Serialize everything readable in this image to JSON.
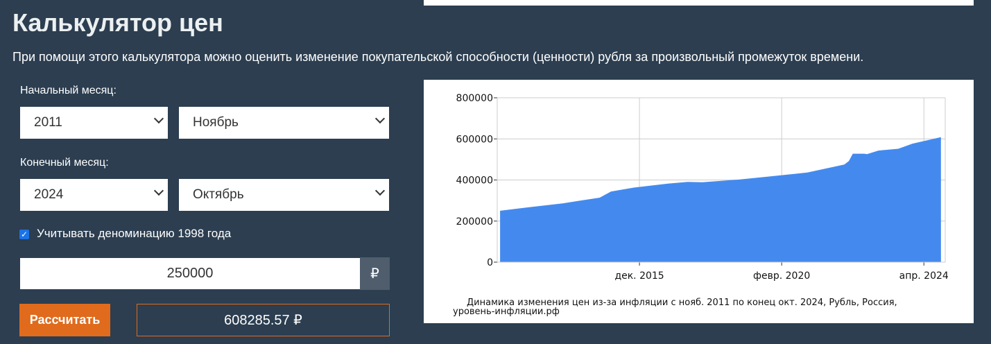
{
  "title": "Калькулятор цен",
  "description": "При помощи этого калькулятора можно оценить изменение покупательской способности (ценности) рубля за произвольный промежуток времени.",
  "start": {
    "label": "Начальный месяц:",
    "year": "2011",
    "month": "Ноябрь"
  },
  "end": {
    "label": "Конечный месяц:",
    "year": "2024",
    "month": "Октябрь"
  },
  "denomination": {
    "label": "Учитывать деноминацию 1998 года",
    "checked": true
  },
  "amount": {
    "value": "250000",
    "currency": "₽"
  },
  "calculate_label": "Рассчитать",
  "result": "608285.57 ₽",
  "colors": {
    "accent": "#e06b1d",
    "fill": "#448aee",
    "bg": "#2c3e50"
  },
  "chart_data": {
    "type": "area",
    "caption_line1": "Динамика изменения цен из-за инфляции с нояб. 2011 по конец окт. 2024, Рубль, Россия,",
    "caption_line2": "уровень-инфляции.рф",
    "x_unit": "months since Nov 2011",
    "xlim": [
      -1,
      156.5
    ],
    "ylim": [
      0,
      800000
    ],
    "yticks": [
      {
        "v": 0,
        "label": "0"
      },
      {
        "v": 200000,
        "label": "200000"
      },
      {
        "v": 400000,
        "label": "400000"
      },
      {
        "v": 600000,
        "label": "600000"
      },
      {
        "v": 800000,
        "label": "800000"
      }
    ],
    "xticks": [
      {
        "v": 49,
        "label": "дек. 2015"
      },
      {
        "v": 99,
        "label": "февр. 2020"
      },
      {
        "v": 149,
        "label": "апр. 2024"
      }
    ],
    "grid": true,
    "points": [
      [
        0,
        250000
      ],
      [
        10,
        267000
      ],
      [
        22,
        286000
      ],
      [
        29,
        301000
      ],
      [
        35,
        314000
      ],
      [
        39,
        344000
      ],
      [
        47,
        363000
      ],
      [
        59,
        382000
      ],
      [
        66,
        391000
      ],
      [
        71,
        389000
      ],
      [
        84,
        402000
      ],
      [
        96,
        419000
      ],
      [
        108,
        436000
      ],
      [
        121,
        475000
      ],
      [
        122.6,
        492000
      ],
      [
        124,
        528000
      ],
      [
        128,
        528000
      ],
      [
        129,
        526000
      ],
      [
        133,
        543000
      ],
      [
        140,
        552000
      ],
      [
        145,
        577000
      ],
      [
        155,
        608286
      ]
    ]
  }
}
